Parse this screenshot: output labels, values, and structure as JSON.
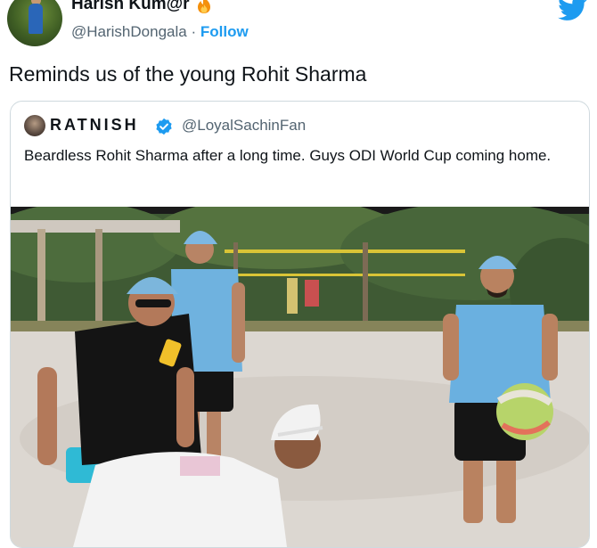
{
  "tweet": {
    "author_name": "Harish Kum@r",
    "author_handle": "@HarishDongala",
    "separator": "·",
    "follow_label": "Follow",
    "text": "Reminds us of the young Rohit Sharma"
  },
  "quoted_tweet": {
    "author_name": "RATNISH",
    "author_handle": "@LoyalSachinFan",
    "text": "Beardless Rohit Sharma after a long time. Guys ODI World Cup coming home."
  },
  "colors": {
    "accent": "#1d9bf0",
    "text_primary": "#0f1419",
    "text_secondary": "#536471",
    "border": "#cfd9de"
  },
  "icons": {
    "brand": "twitter-bird-icon",
    "emoji": "fire-emoji-icon",
    "badge": "verified-badge-icon"
  }
}
